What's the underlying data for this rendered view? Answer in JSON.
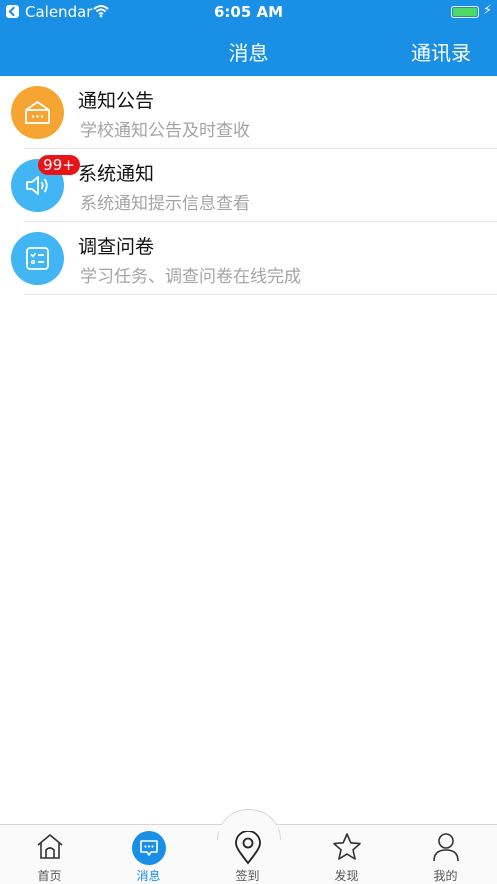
{
  "status_bar": {
    "back_app": "Calendar",
    "time": "6:05 AM"
  },
  "nav": {
    "title": "消息",
    "right_action": "通讯录"
  },
  "messages": [
    {
      "title": "通知公告",
      "subtitle": "学校通知公告及时查收",
      "icon": "bulletin-icon",
      "color": "#f7a532",
      "badge": ""
    },
    {
      "title": "系统通知",
      "subtitle": "系统通知提示信息查看",
      "icon": "speaker-icon",
      "color": "#42b5f4",
      "badge": "99+"
    },
    {
      "title": "调查问卷",
      "subtitle": "学习任务、调查问卷在线完成",
      "icon": "checklist-icon",
      "color": "#42b5f4",
      "badge": ""
    }
  ],
  "tabs": [
    {
      "label": "首页",
      "icon": "home-icon"
    },
    {
      "label": "消息",
      "icon": "message-icon",
      "active": true
    },
    {
      "label": "签到",
      "icon": "location-pin-icon"
    },
    {
      "label": "发现",
      "icon": "star-icon"
    },
    {
      "label": "我的",
      "icon": "person-icon"
    }
  ],
  "colors": {
    "brand_blue": "#1a8fe6",
    "badge_red": "#e8141a",
    "subtitle_gray": "#a4a4a4"
  }
}
